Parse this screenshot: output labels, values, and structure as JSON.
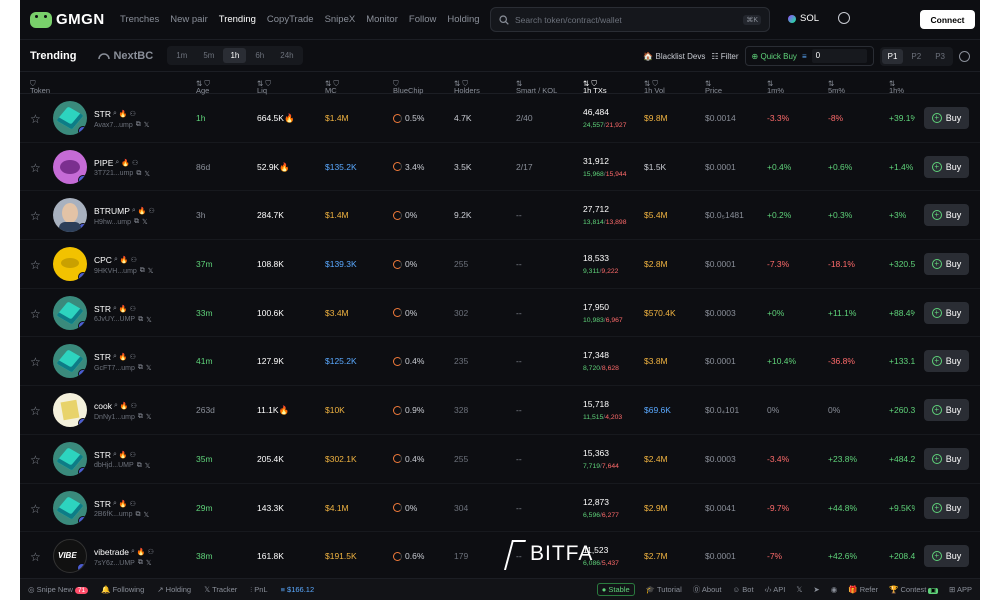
{
  "brand": {
    "logo_text": "GMGN"
  },
  "nav": [
    "Trenches",
    "New pair",
    "Trending",
    "CopyTrade",
    "SnipeX",
    "Monitor",
    "Follow",
    "Holding"
  ],
  "nav_active": "Trending",
  "search": {
    "placeholder": "Search token/contract/wallet",
    "shortcut": "⌘K"
  },
  "chain": {
    "label": "SOL"
  },
  "connect_label": "Connect",
  "toolbar": {
    "title": "Trending",
    "next_tab": "NextBC",
    "timeframes": [
      "1m",
      "5m",
      "1h",
      "6h",
      "24h"
    ],
    "timeframe_active": "1h",
    "blacklist_label": "Blacklist Devs",
    "filter_label": "Filter",
    "quick_buy_label": "Quick Buy",
    "quick_buy_amount": "0",
    "pages": [
      "P1",
      "P2",
      "P3"
    ],
    "page_active": "P1"
  },
  "columns": {
    "token": "Token",
    "age": "Age",
    "liq": "Liq",
    "mc": "MC",
    "bluechip": "BlueChip",
    "holders": "Holders",
    "smart": "Smart / KOL",
    "txs": "1h TXs",
    "vol": "1h Vol",
    "price": "Price",
    "m1": "1m%",
    "m5": "5m%",
    "h1": "1h%"
  },
  "buy_label": "Buy",
  "rows": [
    {
      "sym": "STR",
      "addr": "Avax7...ump",
      "age": "1h",
      "liq": "664.5K",
      "mc": "$1.4M",
      "bc": "0.5%",
      "holders": "4.7K",
      "smart": "2/40",
      "tx": "46,484",
      "buys": "24,557",
      "sells": "21,927",
      "vol": "$9.8M",
      "price": "$0.0014",
      "m1": "-3.3%",
      "m5": "-8%",
      "h1": "+39.1%",
      "avatar": "str",
      "mc_color": "y",
      "vol_color": "y",
      "age_old": false,
      "liq_fire": true,
      "holders_dim": false,
      "m1s": "neg",
      "m5s": "neg"
    },
    {
      "sym": "PIPE",
      "addr": "3T721...ump",
      "age": "86d",
      "liq": "52.9K",
      "mc": "$135.2K",
      "bc": "3.4%",
      "holders": "3.5K",
      "smart": "2/17",
      "tx": "31,912",
      "buys": "15,968",
      "sells": "15,944",
      "vol": "$1.5K",
      "price": "$0.0001",
      "m1": "+0.4%",
      "m5": "+0.6%",
      "h1": "+1.4%",
      "avatar": "pipe",
      "mc_color": "b",
      "vol_color": "w",
      "age_old": true,
      "liq_fire": true,
      "holders_dim": false,
      "m1s": "pos",
      "m5s": "pos"
    },
    {
      "sym": "BTRUMP",
      "addr": "H9hw...ump",
      "age": "3h",
      "liq": "284.7K",
      "mc": "$1.4M",
      "bc": "0%",
      "holders": "9.2K",
      "smart": "--",
      "tx": "27,712",
      "buys": "13,814",
      "sells": "13,898",
      "vol": "$5.4M",
      "price": "$0.0₅1481",
      "m1": "+0.2%",
      "m5": "+0.3%",
      "h1": "+3%",
      "avatar": "btr",
      "mc_color": "y",
      "vol_color": "y",
      "age_old": true,
      "liq_fire": false,
      "holders_dim": false,
      "m1s": "pos",
      "m5s": "pos"
    },
    {
      "sym": "CPC",
      "addr": "9HKVH...ump",
      "age": "37m",
      "liq": "108.8K",
      "mc": "$139.3K",
      "bc": "0%",
      "holders": "255",
      "smart": "--",
      "tx": "18,533",
      "buys": "9,311",
      "sells": "9,222",
      "vol": "$2.8M",
      "price": "$0.0001",
      "m1": "-7.3%",
      "m5": "-18.1%",
      "h1": "+320.5%",
      "avatar": "cpc",
      "mc_color": "b",
      "vol_color": "y",
      "age_old": false,
      "liq_fire": false,
      "holders_dim": true,
      "m1s": "neg",
      "m5s": "neg"
    },
    {
      "sym": "STR",
      "addr": "6JvUY...UMP",
      "age": "33m",
      "liq": "100.6K",
      "mc": "$3.4M",
      "bc": "0%",
      "holders": "302",
      "smart": "--",
      "tx": "17,950",
      "buys": "10,983",
      "sells": "6,967",
      "vol": "$570.4K",
      "price": "$0.0003",
      "m1": "+0%",
      "m5": "+11.1%",
      "h1": "+88.4%",
      "avatar": "str",
      "mc_color": "y",
      "vol_color": "y",
      "age_old": false,
      "liq_fire": false,
      "holders_dim": true,
      "m1s": "pos",
      "m5s": "pos"
    },
    {
      "sym": "STR",
      "addr": "GcFT7...ump",
      "age": "41m",
      "liq": "127.9K",
      "mc": "$125.2K",
      "bc": "0.4%",
      "holders": "235",
      "smart": "--",
      "tx": "17,348",
      "buys": "8,720",
      "sells": "8,628",
      "vol": "$3.8M",
      "price": "$0.0001",
      "m1": "+10.4%",
      "m5": "-36.8%",
      "h1": "+133.1%",
      "avatar": "str",
      "mc_color": "b",
      "vol_color": "y",
      "age_old": false,
      "liq_fire": false,
      "holders_dim": true,
      "m1s": "pos",
      "m5s": "neg"
    },
    {
      "sym": "cook",
      "addr": "DnNy1...ump",
      "age": "263d",
      "liq": "11.1K",
      "mc": "$10K",
      "bc": "0.9%",
      "holders": "328",
      "smart": "--",
      "tx": "15,718",
      "buys": "11,515",
      "sells": "4,203",
      "vol": "$69.6K",
      "price": "$0.0₄101",
      "m1": "0%",
      "m5": "0%",
      "h1": "+260.3%",
      "avatar": "cook",
      "mc_color": "y",
      "vol_color": "b",
      "age_old": true,
      "liq_fire": true,
      "holders_dim": true,
      "m1s": "neu",
      "m5s": "neu"
    },
    {
      "sym": "STR",
      "addr": "dbHjd...UMP",
      "age": "35m",
      "liq": "205.4K",
      "mc": "$302.1K",
      "bc": "0.4%",
      "holders": "255",
      "smart": "--",
      "tx": "15,363",
      "buys": "7,719",
      "sells": "7,644",
      "vol": "$2.4M",
      "price": "$0.0003",
      "m1": "-3.4%",
      "m5": "+23.8%",
      "h1": "+484.2%",
      "avatar": "str",
      "mc_color": "y",
      "vol_color": "y",
      "age_old": false,
      "liq_fire": false,
      "holders_dim": true,
      "m1s": "neg",
      "m5s": "pos"
    },
    {
      "sym": "STR",
      "addr": "2B6fK...ump",
      "age": "29m",
      "liq": "143.3K",
      "mc": "$4.1M",
      "bc": "0%",
      "holders": "304",
      "smart": "--",
      "tx": "12,873",
      "buys": "6,596",
      "sells": "6,277",
      "vol": "$2.9M",
      "price": "$0.0041",
      "m1": "-9.7%",
      "m5": "+44.8%",
      "h1": "+9.5K%",
      "avatar": "str",
      "mc_color": "y",
      "vol_color": "y",
      "age_old": false,
      "liq_fire": false,
      "holders_dim": true,
      "m1s": "neg",
      "m5s": "pos"
    },
    {
      "sym": "vibetrade",
      "addr": "7sY6z...UMP",
      "age": "38m",
      "liq": "161.8K",
      "mc": "$191.5K",
      "bc": "0.6%",
      "holders": "179",
      "smart": "--",
      "tx": "11,523",
      "buys": "6,086",
      "sells": "5,437",
      "vol": "$2.7M",
      "price": "$0.0001",
      "m1": "-7%",
      "m5": "+42.6%",
      "h1": "+208.4%",
      "avatar": "vibe",
      "mc_color": "y",
      "vol_color": "y",
      "age_old": false,
      "liq_fire": false,
      "holders_dim": true,
      "m1s": "neg",
      "m5s": "pos"
    }
  ],
  "watermark": "BITFA",
  "footer": {
    "snipe": "Snipe New",
    "snipe_count": "71",
    "following": "Following",
    "holding": "Holding",
    "tracker": "Tracker",
    "pnl": "PnL",
    "balance": "$166.12",
    "stable": "Stable",
    "tutorial": "Tutorial",
    "about": "About",
    "bot": "Bot",
    "api": "API",
    "refer": "Refer",
    "contest": "Contest",
    "app": "APP"
  }
}
